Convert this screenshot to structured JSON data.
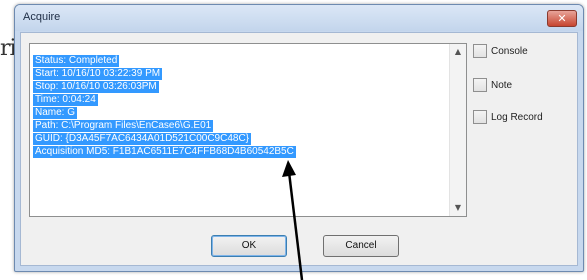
{
  "background": {
    "fragment_text": "ri"
  },
  "dialog": {
    "title": "Acquire",
    "close_glyph": "✕",
    "log_lines": [
      "Status: Completed",
      "Start: 10/16/10 03:22:39 PM",
      "Stop: 10/16/10 03:26:03PM",
      "Time: 0:04:24",
      "Name: G",
      "Path: C:\\Program Files\\EnCase6\\G.E01",
      "GUID: {D3A45F7AC6434A01D521C00C9C48C}",
      "Acquisition MD5: F1B1AC6511E7C4FFB68D4B60542B5C"
    ],
    "options": [
      {
        "label": "Console",
        "checked": false
      },
      {
        "label": "Note",
        "checked": false
      },
      {
        "label": "Log Record",
        "checked": false
      }
    ],
    "ok_label": "OK",
    "cancel_label": "Cancel"
  },
  "colors": {
    "selection": "#3399ff",
    "frame": "#c7d8ee",
    "close": "#c7452f"
  }
}
